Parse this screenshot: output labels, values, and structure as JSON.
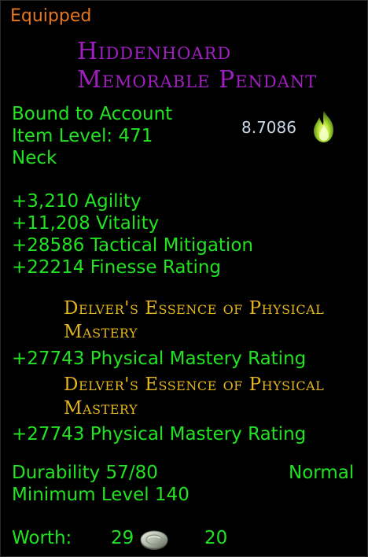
{
  "tooltip": {
    "status": "Equipped",
    "item_name_line1": "Hiddenhoard",
    "item_name_line2": "Memorable Pendant",
    "binding": "Bound to Account",
    "item_level": "Item Level: 471",
    "slot": "Neck",
    "item_rating": "8.7086",
    "rating_icon": "flame-icon",
    "stats": [
      "+3,210 Agility",
      "+11,208 Vitality",
      "+28586 Tactical Mitigation",
      "+22214 Finesse Rating"
    ],
    "essences": [
      {
        "name_line1": "Delver's Essence of Physical",
        "name_line2": "Mastery",
        "stat": "+27743 Physical Mastery Rating"
      },
      {
        "name_line1": "Delver's Essence of Physical",
        "name_line2": "Mastery",
        "stat": "+27743 Physical Mastery Rating"
      }
    ],
    "durability": "Durability 57/80",
    "quality": "Normal",
    "min_level": "Minimum Level 140",
    "worth_label": "Worth:",
    "worth_gold": "29",
    "worth_silver": "20",
    "coin_icon": "silver-coin-icon",
    "colors": {
      "status": "#e6771e",
      "name": "#a11fc2",
      "stat": "#22e222",
      "essence": "#e3b51e",
      "rating": "#c8d8e8"
    }
  }
}
